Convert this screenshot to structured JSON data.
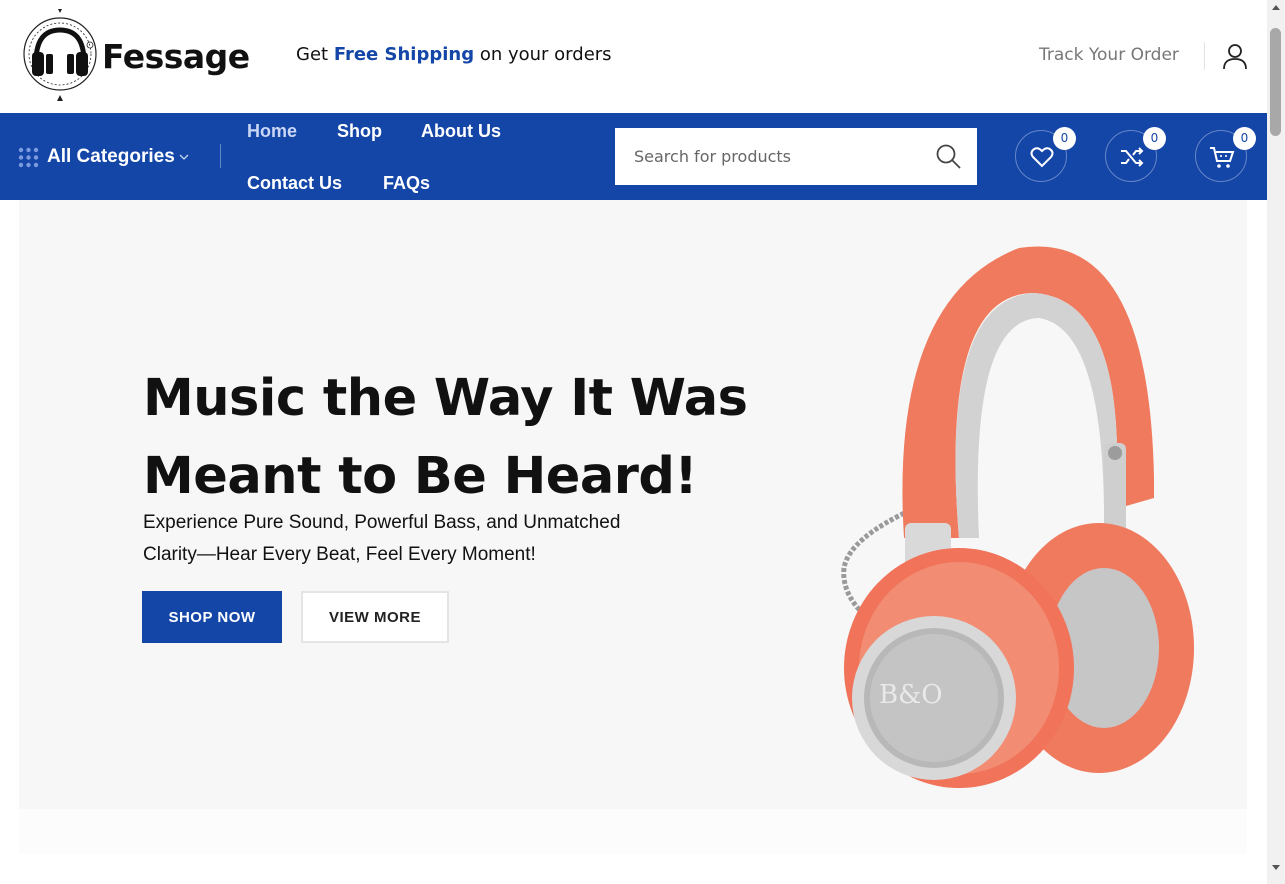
{
  "header": {
    "logo_text": "Fessage",
    "promo_prefix": "Get ",
    "promo_highlight": "Free Shipping",
    "promo_suffix": " on your orders",
    "track_order": "Track Your Order"
  },
  "nav": {
    "categories_label": "All Categories",
    "menu": [
      "Home",
      "Shop",
      "About Us",
      "Contact Us",
      "FAQs"
    ],
    "search_placeholder": "Search for products",
    "wishlist_count": "0",
    "compare_count": "0",
    "cart_count": "0"
  },
  "hero": {
    "title_line1": "Music the Way It Was",
    "title_line2": "Meant to Be Heard!",
    "subtitle_line1": "Experience Pure Sound, Powerful Bass, and Unmatched",
    "subtitle_line2": "Clarity—Hear Every Beat, Feel Every Moment!",
    "shop_now": "SHOP NOW",
    "view_more": "VIEW MORE",
    "product_brand_mark": "B&O"
  },
  "colors": {
    "primary": "#1446a8",
    "headphone_coral": "#f07a5e",
    "headphone_grey": "#c9c9c9",
    "hero_bg": "#f7f7f7"
  }
}
